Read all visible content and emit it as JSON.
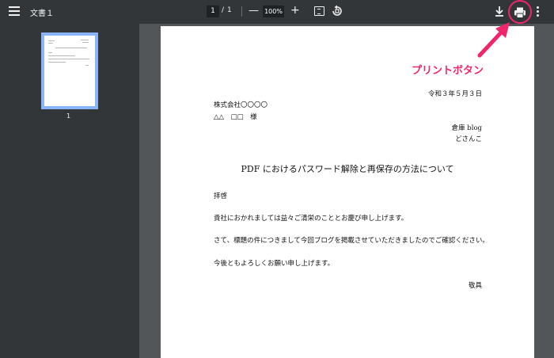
{
  "toolbar": {
    "title": "文書１",
    "current_page": "1",
    "separator": "/",
    "total_pages": "1",
    "zoom_minus": "—",
    "zoom_level": "100%",
    "zoom_plus": "+",
    "icons": [
      "menu-icon",
      "fit-to-page-icon",
      "rotate-icon",
      "download-icon",
      "print-icon",
      "more-options-icon"
    ]
  },
  "sidebar": {
    "thumbnail_label": "1"
  },
  "document": {
    "date": "令和３年５月３日",
    "company": "株式会社〇〇〇〇",
    "addressee": "△△　□□　様",
    "sender_org": "倉庫 blog",
    "sender_name": "どさんこ",
    "heading": "PDF におけるパスワード解除と再保存の方法について",
    "greeting": "拝啓",
    "paragraph_1": "貴社におかれましては益々ご清栄のこととお慶び申し上げます。",
    "paragraph_2": "さて、標題の件につきまして今回ブログを掲載させていただきましたのでご確認ください。",
    "paragraph_3": "今後ともよろしくお願い申し上げます。",
    "closing": "敬具"
  },
  "annotation": {
    "label": "プリントボタン",
    "color": "#f0256b"
  },
  "colors": {
    "toolbar_bg": "#323639",
    "viewer_bg": "#525659",
    "thumb_border": "#8ab4f8",
    "accent": "#f0256b"
  }
}
